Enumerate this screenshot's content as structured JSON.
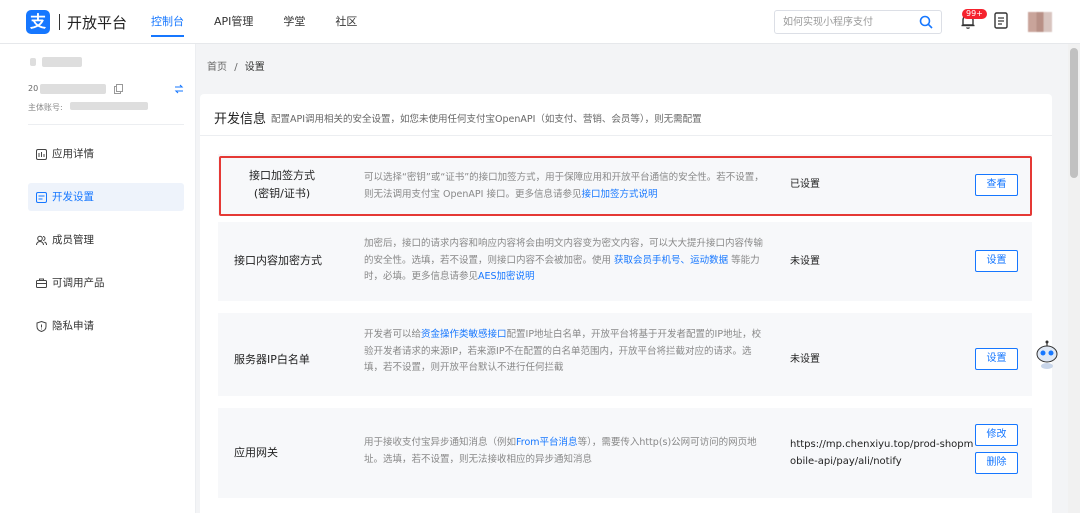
{
  "header": {
    "logo_text": "开放平台",
    "nav": [
      "控制台",
      "API管理",
      "学堂",
      "社区"
    ],
    "search_placeholder": "如何实现小程序支付",
    "notification_badge": "99+"
  },
  "sidebar": {
    "account_id_prefix": "20",
    "account_main_label": "主体账号:",
    "items": [
      {
        "label": "应用详情",
        "icon": "app-detail-icon"
      },
      {
        "label": "开发设置",
        "icon": "dev-settings-icon",
        "active": true
      },
      {
        "label": "成员管理",
        "icon": "members-icon"
      },
      {
        "label": "可调用产品",
        "icon": "products-icon"
      },
      {
        "label": "隐私申请",
        "icon": "privacy-icon"
      }
    ]
  },
  "breadcrumb": {
    "home": "首页",
    "sep": "/",
    "current": "设置"
  },
  "section": {
    "title": "开发信息",
    "subtitle": "配置API调用相关的安全设置，如您未使用任何支付宝OpenAPI（如支付、营销、会员等），则无需配置"
  },
  "rows": [
    {
      "name_lines": [
        "接口加签方式",
        "(密钥/证书)"
      ],
      "desc_parts": [
        {
          "t": "可以选择“密钥”或“证书”的接口加签方式，用于保障应用和开放平台通信的安全性。若不设置，则无法调用支付宝 OpenAPI 接口。更多信息请参见"
        },
        {
          "t": "接口加签方式说明",
          "link": true
        }
      ],
      "status": "已设置",
      "buttons": [
        "查看"
      ]
    },
    {
      "name_lines": [
        "接口内容加密方式"
      ],
      "desc_parts": [
        {
          "t": "加密后，接口的请求内容和响应内容将会由明文内容变为密文内容，可以大大提升接口内容传输的安全性。选填，若不设置，则接口内容不会被加密。使用 "
        },
        {
          "t": "获取会员手机号",
          "link": true
        },
        {
          "t": "、"
        },
        {
          "t": "运动数据",
          "link": true
        },
        {
          "t": " 等能力时，必填。更多信息请参见"
        },
        {
          "t": "AES加密说明",
          "link": true
        }
      ],
      "status": "未设置",
      "buttons": [
        "设置"
      ]
    },
    {
      "name_lines": [
        "服务器IP白名单"
      ],
      "desc_parts": [
        {
          "t": "开发者可以给"
        },
        {
          "t": "资金操作类敏感接口",
          "link": true
        },
        {
          "t": "配置IP地址白名单，开放平台将基于开发者配置的IP地址，校验开发者请求的来源IP，若来源IP不在配置的白名单范围内，开放平台将拦截对应的请求。选填，若不设置，则开放平台默认不进行任何拦截"
        }
      ],
      "status": "未设置",
      "buttons": [
        "设置"
      ]
    },
    {
      "name_lines": [
        "应用网关"
      ],
      "desc_parts": [
        {
          "t": "用于接收支付宝异步通知消息（例如"
        },
        {
          "t": "From平台消息",
          "link": true
        },
        {
          "t": "等），需要传入http(s)公网可访问的网页地址。选填，若不设置，则无法接收相应的异步通知消息"
        }
      ],
      "status_lines": [
        "https://mp.chenxiyu.top/prod-shopm",
        "obile-api/pay/ali/notify"
      ],
      "buttons": [
        "修改",
        "删除"
      ]
    }
  ],
  "colors": {
    "accent": "#1677ff",
    "highlight": "#e53935",
    "badge": "#f5222d"
  }
}
